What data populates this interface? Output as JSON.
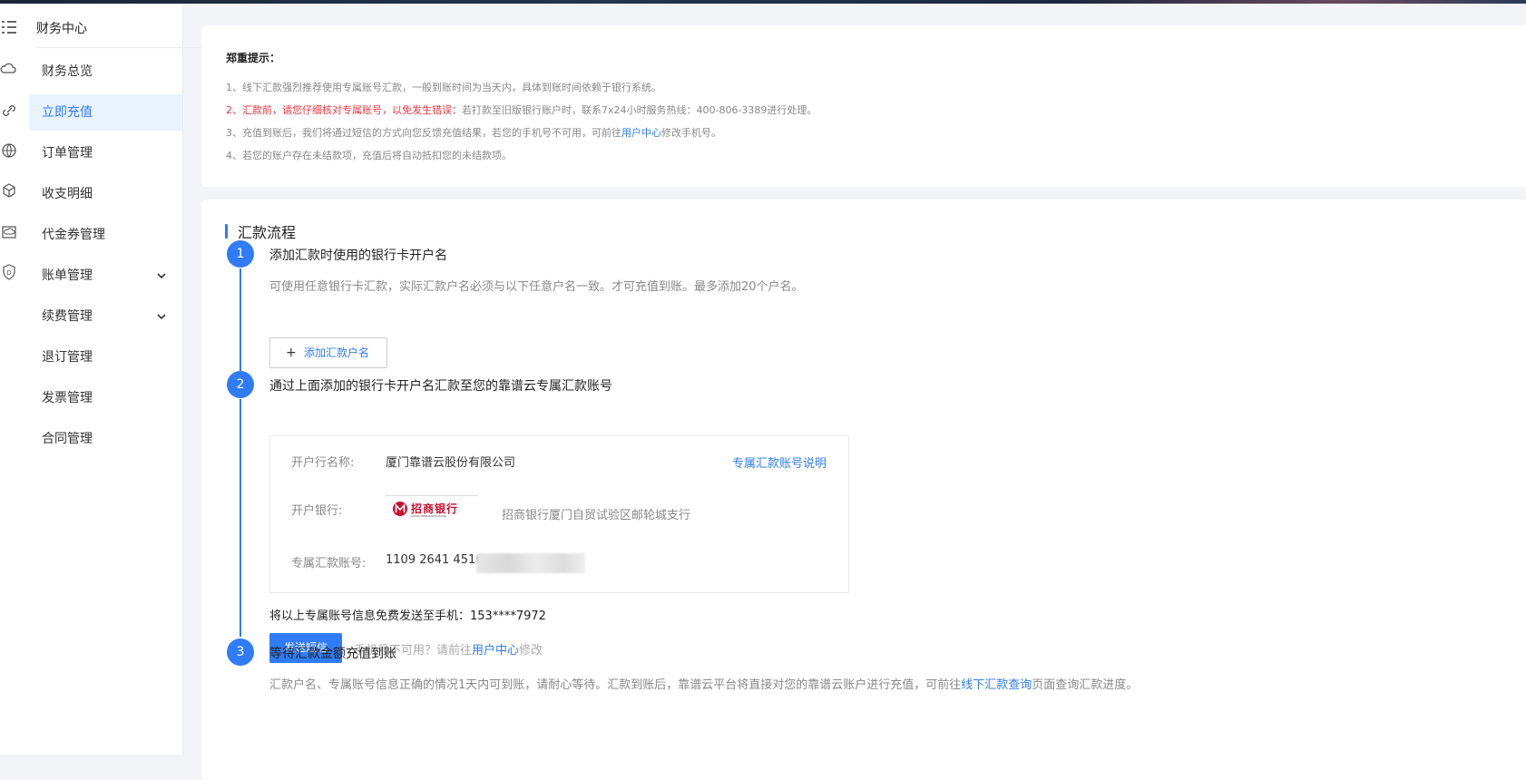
{
  "menu": {
    "title": "财务中心",
    "items": [
      {
        "label": "财务总览"
      },
      {
        "label": "立即充值"
      },
      {
        "label": "订单管理"
      },
      {
        "label": "收支明细"
      },
      {
        "label": "代金券管理"
      },
      {
        "label": "账单管理"
      },
      {
        "label": "续费管理"
      },
      {
        "label": "退订管理"
      },
      {
        "label": "发票管理"
      },
      {
        "label": "合同管理"
      }
    ],
    "active_index": 1
  },
  "notice": {
    "title": "郑重提示：",
    "line1": "1、线下汇款强烈推荐使用专属账号汇款，一般到账时间为当天内，具体到账时间依赖于银行系统。",
    "line2_red": "2、汇款前，请您仔细核对专属账号，以免发生错误：",
    "line2_rest": "若打款至旧版银行账户时，联系7x24小时服务热线：400-806-3389进行处理。",
    "line3_pre": "3、充值到账后，我们将通过短信的方式向您反馈充值结果，若您的手机号不可用，可前往",
    "line3_link": "用户中心",
    "line3_post": "修改手机号。",
    "line4": "4、若您的账户存在未结款项，充值后将自动抵扣您的未结款项。"
  },
  "flow": {
    "title": "汇款流程",
    "step1": {
      "num": "1",
      "title": "添加汇款时使用的银行卡开户名",
      "desc": "可使用任意银行卡汇款，实际汇款户名必须与以下任意户名一致。才可充值到账。最多添加20个户名。",
      "add_plus": "+",
      "add_label": "添加汇款户名"
    },
    "step2": {
      "num": "2",
      "title": "通过上面添加的银行卡开户名汇款至您的靠谱云专属汇款账号",
      "account_name_label": "开户行名称:",
      "account_name": "厦门靠谱云股份有限公司",
      "explain_link": "专属汇款账号说明",
      "bank_label": "开户银行:",
      "bank_logo_text": "招商银行",
      "bank_logo_sub": "CHINA MERCHANTS BANK",
      "bank_name": "招商银行厦门自贸试验区邮轮城支行",
      "account_no_label": "专属汇款账号:",
      "account_no": "1109 2641 4510",
      "sms_text": "将以上专属账号信息免费发送至手机：153****7972",
      "sms_button": "发送短信",
      "sms_hint_pre": "手机号不可用？请前往",
      "sms_hint_link": "用户中心",
      "sms_hint_post": "修改"
    },
    "step3": {
      "num": "3",
      "title": "等待汇款金额充值到账",
      "desc_pre": "汇款户名、专属账号信息正确的情况1天内可到账，请耐心等待。汇款到账后，靠谱云平台将直接对您的靠谱云账户进行充值，可前往",
      "desc_link": "线下汇款查询",
      "desc_post": "页面查询汇款进度。"
    }
  },
  "colors": {
    "accent": "#2f7cf6",
    "warning": "#f5323c",
    "active_bg": "#e8f3fe"
  },
  "icons": [
    "menu-icon",
    "cloud-icon",
    "link-icon",
    "globe-icon",
    "cube-icon",
    "cloud-drive-icon",
    "shield-icon",
    "chevron-down-icon"
  ]
}
